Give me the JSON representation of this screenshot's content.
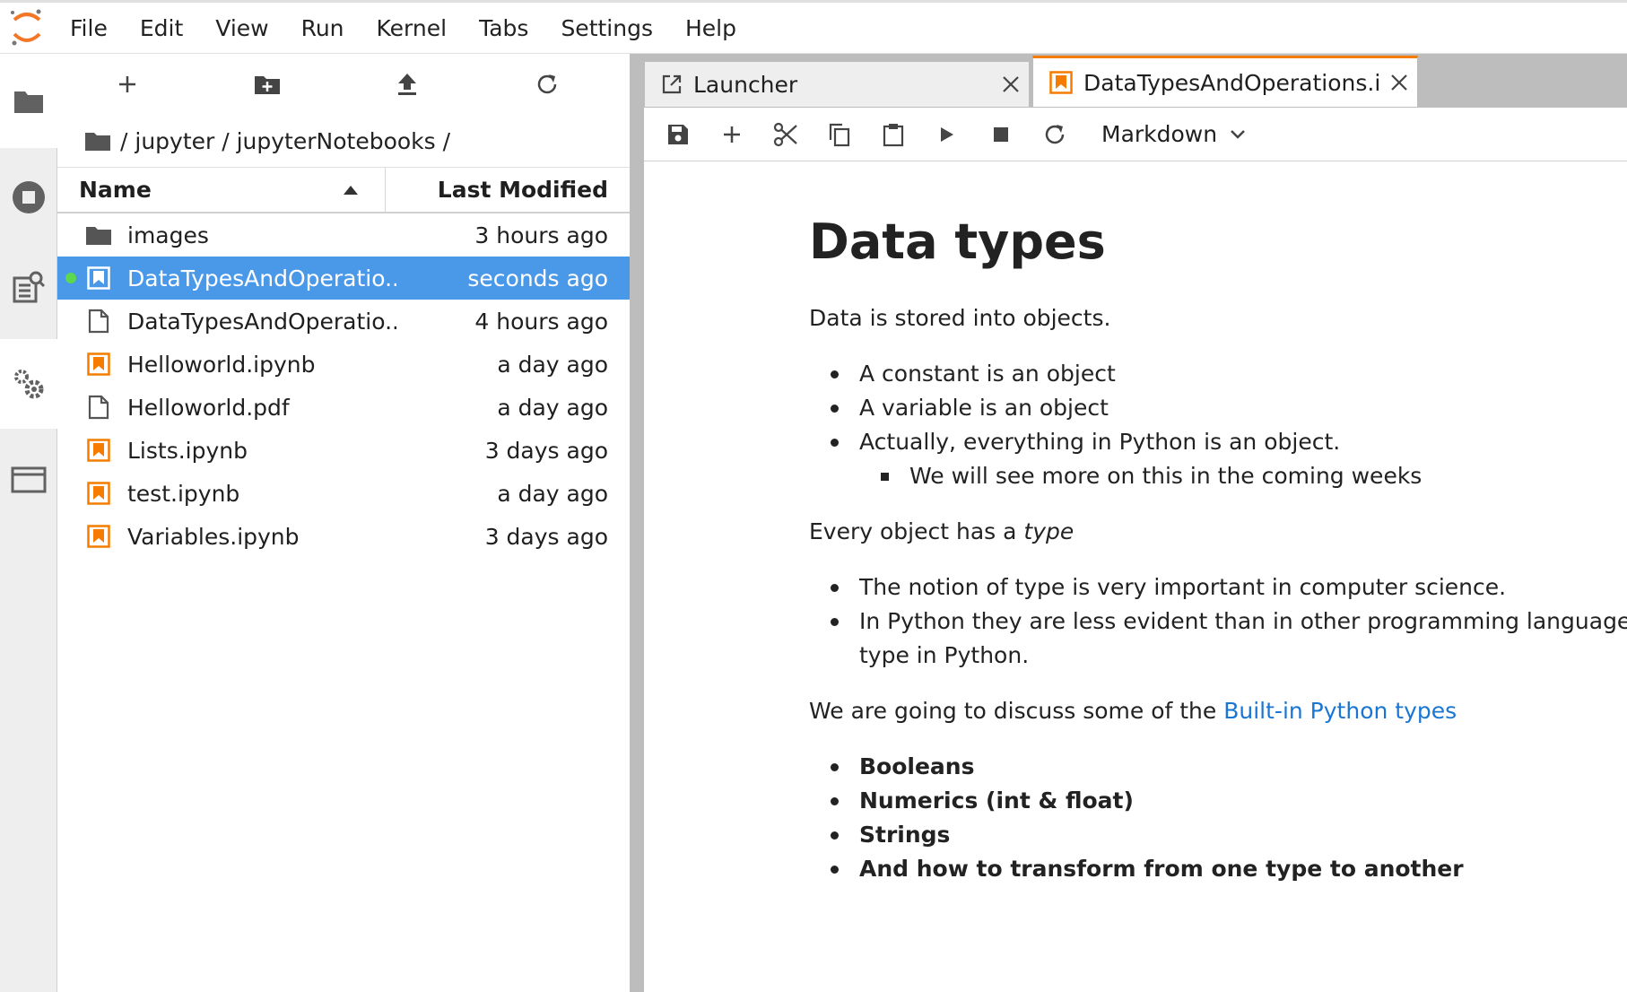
{
  "menubar": {
    "items": [
      "File",
      "Edit",
      "View",
      "Run",
      "Kernel",
      "Tabs",
      "Settings",
      "Help"
    ]
  },
  "sidebar": {
    "icons": [
      "folder-icon",
      "running-icon",
      "commands-icon",
      "property-inspector-icon",
      "tabs-icon"
    ]
  },
  "filebrowser": {
    "breadcrumb": "/ jupyter / jupyterNotebooks /",
    "columns": {
      "name": "Name",
      "modified": "Last Modified"
    },
    "rows": [
      {
        "name": "images",
        "modified": "3 hours ago",
        "type": "folder"
      },
      {
        "name": "DataTypesAndOperatio...",
        "modified": "seconds ago",
        "type": "notebook"
      },
      {
        "name": "DataTypesAndOperatio...",
        "modified": "4 hours ago",
        "type": "file"
      },
      {
        "name": "Helloworld.ipynb",
        "modified": "a day ago",
        "type": "notebook"
      },
      {
        "name": "Helloworld.pdf",
        "modified": "a day ago",
        "type": "file"
      },
      {
        "name": "Lists.ipynb",
        "modified": "3 days ago",
        "type": "notebook"
      },
      {
        "name": "test.ipynb",
        "modified": "a day ago",
        "type": "notebook"
      },
      {
        "name": "Variables.ipynb",
        "modified": "3 days ago",
        "type": "notebook"
      }
    ]
  },
  "tabs": [
    {
      "label": "Launcher"
    },
    {
      "label": "DataTypesAndOperations.ipynb"
    }
  ],
  "notebook_toolbar": {
    "cell_type": "Markdown"
  },
  "markdown": {
    "title": "Data types",
    "p1": "Data is stored into objects.",
    "list1": [
      "A constant is an object",
      "A variable is an object",
      "Actually, everything in Python is an object."
    ],
    "sublist1": [
      "We will see more on this in the coming weeks"
    ],
    "p2_prefix": "Every object has a ",
    "p2_emph": "type",
    "list2": [
      "The notion of type is very important in computer science.",
      "In Python they are less evident than in other programming languages."
    ],
    "list2_cont": "type in Python.",
    "p3_prefix": "We are going to discuss some of the ",
    "p3_link": "Built-in Python types",
    "list3": [
      "Booleans",
      "Numerics (int & float)",
      "Strings",
      "And how to transform from one type to another"
    ]
  },
  "colors": {
    "accent": "#f57c00",
    "selection": "#4a98e8",
    "link": "#1976d2",
    "running": "#5cd84e"
  }
}
